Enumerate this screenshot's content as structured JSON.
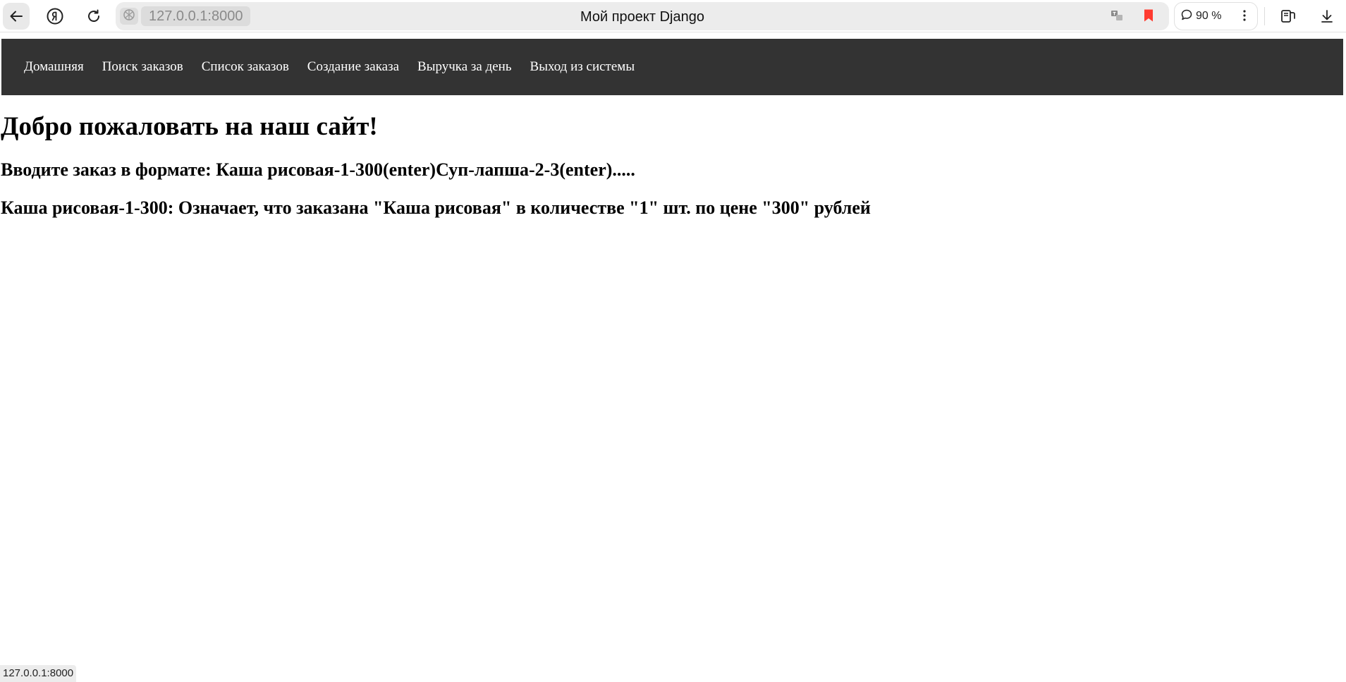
{
  "browser": {
    "url": "127.0.0.1:8000",
    "tab_title": "Мой проект Django",
    "zoom": "90 %",
    "status_url": "127.0.0.1:8000",
    "icons": {
      "back": "back-arrow-icon",
      "yandex": "yandex-logo-icon",
      "reload": "reload-icon",
      "site": "globe-icon",
      "translate": "translate-icon",
      "bookmark": "bookmark-icon",
      "zoom": "chat-bubble-icon",
      "menu": "kebab-menu-icon",
      "sidebar": "sidebar-icon",
      "download": "download-icon"
    },
    "bookmark_color": "#ff3b30"
  },
  "nav": {
    "items": [
      {
        "label": "Домашняя"
      },
      {
        "label": "Поиск заказов"
      },
      {
        "label": "Список заказов"
      },
      {
        "label": "Создание заказа"
      },
      {
        "label": "Выручка за день"
      },
      {
        "label": "Выход из системы"
      }
    ],
    "background": "#333333"
  },
  "main": {
    "title": "Добро пожаловать на наш сайт!",
    "format_hint": "Вводите заказ в формате: Каша рисовая-1-300(enter)Суп-лапша-2-3(enter).....",
    "example": "Каша рисовая-1-300: Означает, что заказана \"Каша рисовая\" в количестве \"1\" шт. по цене \"300\" рублей"
  }
}
